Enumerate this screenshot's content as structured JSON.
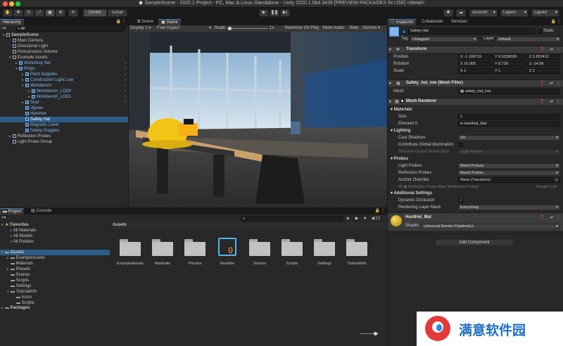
{
  "window": {
    "title": "SampleScene - 2020.1 Project - PC, Mac & Linux Standalone - Unity 2020.1.0b4.3439 [PREVIEW PACKAGES IN USE] <Metal>"
  },
  "toolbar": {
    "center": "Center",
    "local": "Local",
    "account": "Account",
    "layers": "Layers",
    "layout": "Layout"
  },
  "hierarchy": {
    "tab": "Hierarchy",
    "search": "All",
    "items": [
      {
        "label": "SampleScene",
        "depth": 0,
        "blue": false,
        "bold": true,
        "arrow": "▾"
      },
      {
        "label": "Main Camera",
        "depth": 1,
        "blue": false
      },
      {
        "label": "Directional Light",
        "depth": 1,
        "blue": false
      },
      {
        "label": "Post-process Volume",
        "depth": 1,
        "blue": false
      },
      {
        "label": "Example Assets",
        "depth": 1,
        "blue": false,
        "arrow": "▾"
      },
      {
        "label": "Workshop Set",
        "depth": 2,
        "blue": true,
        "arrow": "▸"
      },
      {
        "label": "Props",
        "depth": 2,
        "blue": true,
        "arrow": "▾"
      },
      {
        "label": "Paint Supplies",
        "depth": 3,
        "blue": true,
        "arrow": "▸"
      },
      {
        "label": "Construction Light Low",
        "depth": 3,
        "blue": true,
        "arrow": "▸"
      },
      {
        "label": "Workbench",
        "depth": 3,
        "blue": true,
        "arrow": "▾"
      },
      {
        "label": "Workbench_LOD0",
        "depth": 4,
        "blue": true,
        "arrow": "▸"
      },
      {
        "label": "Workbench_LOD1",
        "depth": 4,
        "blue": true,
        "arrow": "▸"
      },
      {
        "label": "Stud",
        "depth": 3,
        "blue": true,
        "arrow": "▸"
      },
      {
        "label": "Jigsaw",
        "depth": 3,
        "blue": true
      },
      {
        "label": "Hammer",
        "depth": 3,
        "blue": true
      },
      {
        "label": "Safety Hat",
        "depth": 3,
        "blue": true,
        "selected": true
      },
      {
        "label": "Magnetic Level",
        "depth": 3,
        "blue": true
      },
      {
        "label": "Safety Goggles",
        "depth": 3,
        "blue": true
      },
      {
        "label": "Reflection Probes",
        "depth": 1,
        "blue": false,
        "arrow": "▸"
      },
      {
        "label": "Light Probe Group",
        "depth": 1,
        "blue": false
      }
    ]
  },
  "scene_view": {
    "tabs": [
      "Scene",
      "Game"
    ],
    "display": "Display 1",
    "aspect": "Free Aspect",
    "scale_label": "Scale",
    "scale_value": "1x",
    "options": [
      "Maximize On Play",
      "Mute Audio",
      "Stats",
      "Gizmos"
    ]
  },
  "inspector": {
    "tabs": [
      "Inspector",
      "Collaborate",
      "Services"
    ],
    "object_name": "Safety Hat",
    "static": "Static",
    "tag_label": "Tag",
    "tag": "Untagged",
    "layer_label": "Layer",
    "layer": "Default",
    "transform": {
      "title": "Transform",
      "rows": [
        {
          "label": "Position",
          "x": "X -1.108719",
          "y": "Y 0.9158028",
          "z": "Z 2.832412"
        },
        {
          "label": "Rotation",
          "x": "X 10.005",
          "y": "Y 8.739",
          "z": "Z -14.99"
        },
        {
          "label": "Scale",
          "x": "X 1",
          "y": "Y 1",
          "z": "Z 1"
        }
      ]
    },
    "mesh_filter": {
      "title": "Safety_hat_low (Mesh Filter)",
      "mesh_label": "Mesh",
      "mesh": "safety_hat_low"
    },
    "mesh_renderer": {
      "title": "Mesh Renderer",
      "materials": "Materials",
      "size_label": "Size",
      "size": "1",
      "element_label": "Element 0",
      "element": "HardHat_Mat",
      "lighting": "Lighting",
      "cast_shadows_label": "Cast Shadows",
      "cast_shadows": "On",
      "contribute_gi": "Contribute Global Illumination",
      "receive_gi_label": "Receive Global Illumination",
      "receive_gi": "Light Probes",
      "probes": "Probes",
      "light_probes_label": "Light Probes",
      "light_probes": "Blend Probes",
      "reflection_probes_label": "Reflection Probes",
      "reflection_probes": "Blend Probes",
      "anchor_label": "Anchor Override",
      "anchor": "None (Transform)",
      "probe_ref": "Reflection Probe Main (Reflection Probe)",
      "weight": "Weight 1.00",
      "additional": "Additional Settings",
      "dyn_occ": "Dynamic Occlusion",
      "render_mask_label": "Rendering Layer Mask",
      "render_mask": "Everything"
    },
    "material": {
      "name": "HardHat_Mat",
      "shader_label": "Shader",
      "shader": "Universal Render Pipeline/Lit"
    },
    "add_component": "Add Component"
  },
  "project": {
    "tabs": [
      "Project",
      "Console"
    ],
    "search_count": "13",
    "favorites": {
      "label": "Favorites",
      "items": [
        "All Materials",
        "All Models",
        "All Prefabs"
      ]
    },
    "tree": [
      {
        "label": "Assets",
        "depth": 0,
        "arrow": "▾",
        "selected": true
      },
      {
        "label": "ExampleAssets",
        "depth": 1,
        "arrow": "▸"
      },
      {
        "label": "Materials",
        "depth": 1
      },
      {
        "label": "Presets",
        "depth": 1,
        "arrow": "▸"
      },
      {
        "label": "Scenes",
        "depth": 1
      },
      {
        "label": "Scripts",
        "depth": 1
      },
      {
        "label": "Settings",
        "depth": 1
      },
      {
        "label": "TutorialInfo",
        "depth": 1,
        "arrow": "▾"
      },
      {
        "label": "Icons",
        "depth": 2
      },
      {
        "label": "Scripts",
        "depth": 2
      }
    ],
    "packages": "Packages",
    "assets_header": "Assets",
    "assets": [
      {
        "label": "ExampleAssets",
        "kind": "folder"
      },
      {
        "label": "Materials",
        "kind": "folder"
      },
      {
        "label": "Presets",
        "kind": "folder"
      },
      {
        "label": "Readme",
        "kind": "readme"
      },
      {
        "label": "Scenes",
        "kind": "folder"
      },
      {
        "label": "Scripts",
        "kind": "folder"
      },
      {
        "label": "Settings",
        "kind": "folder"
      },
      {
        "label": "TutorialInfo",
        "kind": "folder"
      }
    ]
  },
  "watermark": {
    "text": "满意软件园"
  },
  "colors": {
    "accent": "#3a79bb",
    "selection": "#2c5d87",
    "prefab_blue": "#7fb8f3",
    "panel": "#282828",
    "hat_yellow": "#f2c515"
  }
}
